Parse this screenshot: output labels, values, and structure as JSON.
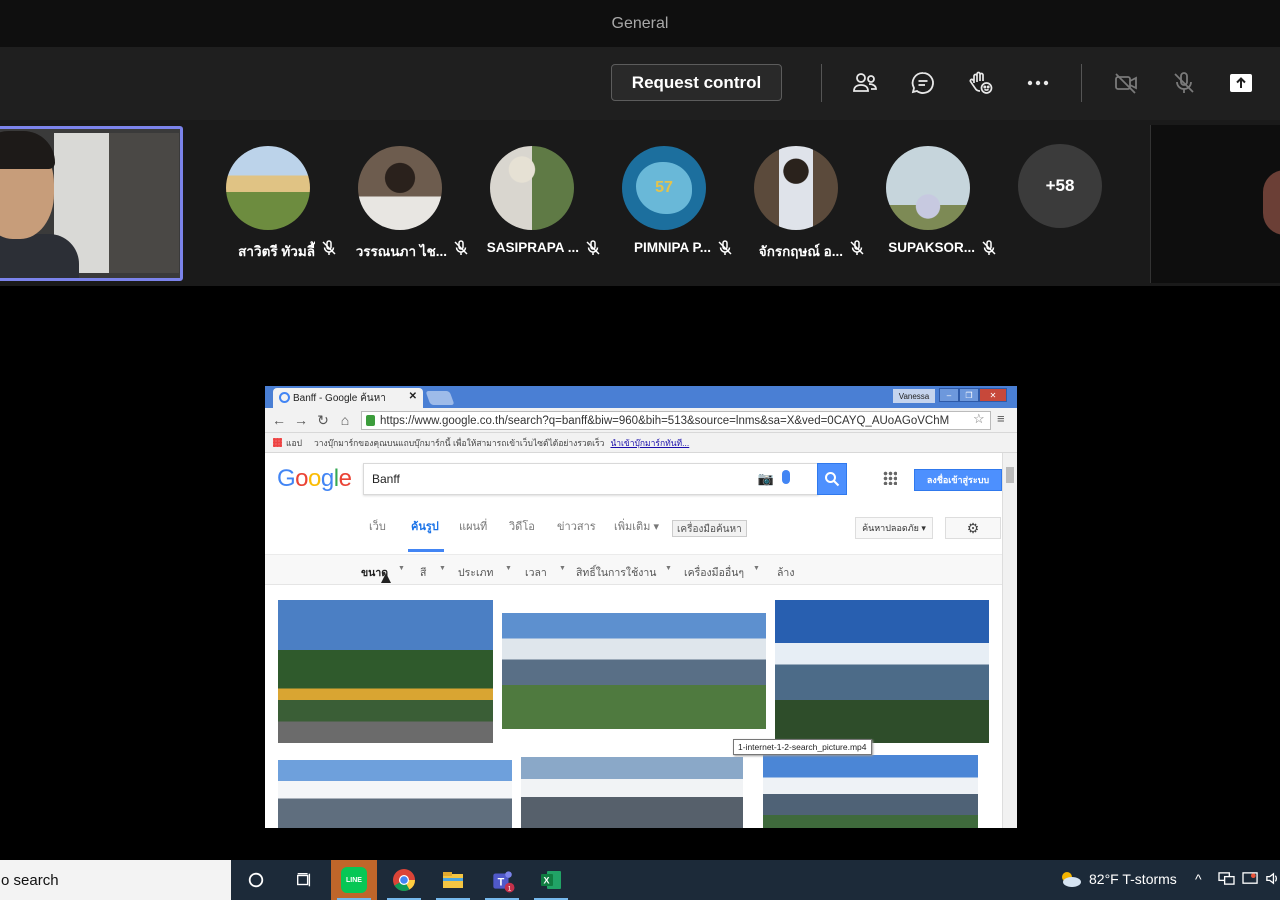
{
  "window": {
    "title": "General"
  },
  "toolbar": {
    "request_control_label": "Request control",
    "icons": [
      "people-icon",
      "chat-icon",
      "raise-hand-icon",
      "more-options-icon",
      "camera-off-icon",
      "mic-off-icon",
      "share-tray-icon"
    ]
  },
  "participants": [
    {
      "name": "สาวิตรี ทัวมลี้",
      "avatar_color": "#6e8a4a"
    },
    {
      "name": "วรรณนภา ไช...",
      "avatar_color": "#6b5a4c"
    },
    {
      "name": "SASIPRAPA ...",
      "avatar_color": "#8b8f7a"
    },
    {
      "name": "PIMNIPA P...",
      "avatar_color": "#1c6f9e",
      "avatar_text": "57"
    },
    {
      "name": "จักรกฤษณ์ อ...",
      "avatar_color": "#7d6a58"
    },
    {
      "name": "SUPAKSOR...",
      "avatar_color": "#9ab0b8"
    }
  ],
  "more_participants": "+58",
  "shared_browser": {
    "tab_title": "Banff - Google ค้นหา",
    "window_user": "Vanessa",
    "url": "https://www.google.co.th/search?q=banff&biw=960&bih=513&source=lnms&sa=X&ved=0CAYQ_AUoAGoVChM",
    "bookmarks": {
      "apps": "แอป",
      "text": "วางบุ๊กมาร์กของคุณบนแถบบุ๊กมาร์กนี้ เพื่อให้สามารถเข้าเว็บไซต์ได้อย่างรวดเร็ว",
      "link": "นำเข้าบุ๊กมาร์กทันที..."
    },
    "google": {
      "logo": "Google",
      "query": "Banff",
      "signin": "ลงชื่อเข้าสู่ระบบ",
      "tabs": [
        "เว็บ",
        "ค้นรูป",
        "แผนที่",
        "วิดีโอ",
        "ข่าวสาร",
        "เพิ่มเติม ▾"
      ],
      "tools_button": "เครื่องมือค้นหา",
      "safe_search": "ค้นหาปลอดภัย ▾",
      "filters": [
        "ขนาด",
        "สี",
        "ประเภท",
        "เวลา",
        "สิทธิ์ในการใช้งาน",
        "เครื่องมืออื่นๆ",
        "ล้าง"
      ],
      "tooltip": "1-internet-1-2-search_picture.mp4"
    }
  },
  "taskbar": {
    "search_text": "o search",
    "weather": "82°F  T-storms"
  },
  "colors": {
    "accent": "#7b83eb",
    "titlebar": "#0f0f0f",
    "toolbar": "#1f1f1f",
    "strip": "#1a1a1a",
    "taskbar": "#1c2a39"
  }
}
